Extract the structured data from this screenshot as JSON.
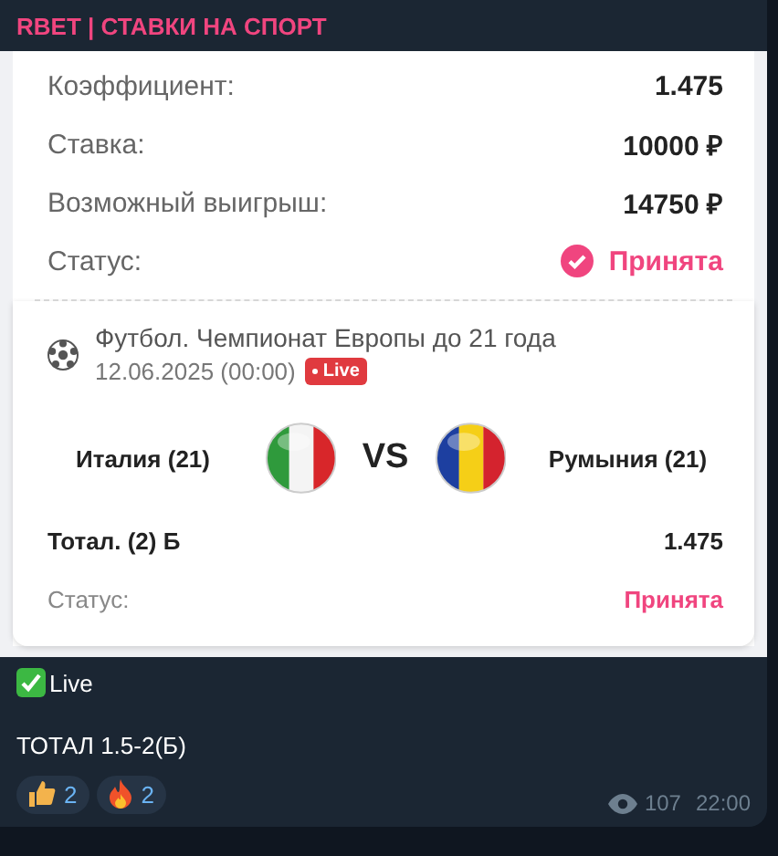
{
  "channel": {
    "title": "RBET | СТАВКИ НА СПОРТ"
  },
  "bet_summary": {
    "rows": [
      {
        "label": "Коэффициент:",
        "value": "1.475"
      },
      {
        "label": "Ставка:",
        "value": "10000 ₽"
      },
      {
        "label": "Возможный выигрыш:",
        "value": "14750 ₽"
      }
    ],
    "status": {
      "label": "Статус:",
      "value": "Принята"
    }
  },
  "event": {
    "sport": "Футбол. Чемпионат Европы до 21 года",
    "datetime": "12.06.2025 (00:00)",
    "badge": "Live",
    "vs": "VS",
    "teams": [
      {
        "name": "Италия (21)",
        "kind": "italy"
      },
      {
        "name": "Румыния (21)",
        "kind": "romania"
      }
    ],
    "market": "Тотал. (2) Б",
    "odds": "1.475",
    "status_label": "Статус:",
    "status_value": "Принята"
  },
  "message": {
    "lines": [
      {
        "kind": "check",
        "text": "Live"
      },
      {
        "kind": "plain",
        "text": "ТОТАЛ 1.5-2(Б)"
      }
    ]
  },
  "reactions": [
    {
      "kind": "thumbs-up",
      "count": "2"
    },
    {
      "kind": "fire",
      "count": "2"
    }
  ],
  "views": "107",
  "time": "22:00"
}
